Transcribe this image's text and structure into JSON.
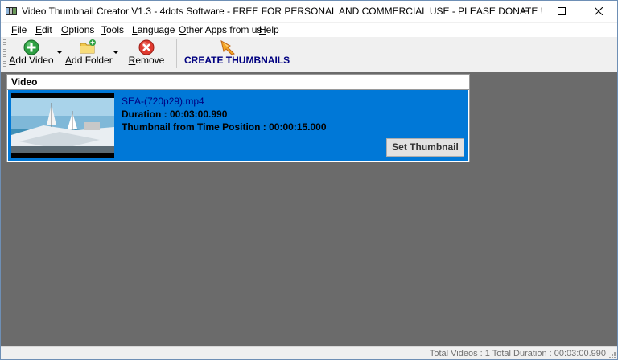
{
  "window": {
    "title": "Video Thumbnail Creator V1.3 - 4dots Software - FREE FOR PERSONAL AND COMMERCIAL USE - PLEASE DONATE !"
  },
  "menu": [
    "File",
    "Edit",
    "Options",
    "Tools",
    "Language",
    "Other Apps from us",
    "Help"
  ],
  "toolbar": {
    "add_video": "Add Video",
    "add_folder": "Add Folder",
    "remove": "Remove",
    "create_thumbnails": "CREATE THUMBNAILS"
  },
  "panel": {
    "header": "Video",
    "items": [
      {
        "filename": "SEA-(720p29).mp4",
        "duration": "Duration : 00:03:00.990",
        "thumbnail_position": "Thumbnail from Time Position : 00:00:15.000",
        "button": "Set Thumbnail"
      }
    ]
  },
  "status": {
    "text": "Total Videos : 1  Total Duration : 00:03:00.990"
  },
  "colors": {
    "selection": "#0078d7",
    "workspace": "#6b6b6b",
    "filename_text": "#000080"
  },
  "icons": {
    "add_video": "green-plus-circle-icon",
    "add_folder": "folder-add-icon",
    "remove": "red-x-circle-icon",
    "create": "arrow-thumbnail-icon"
  }
}
